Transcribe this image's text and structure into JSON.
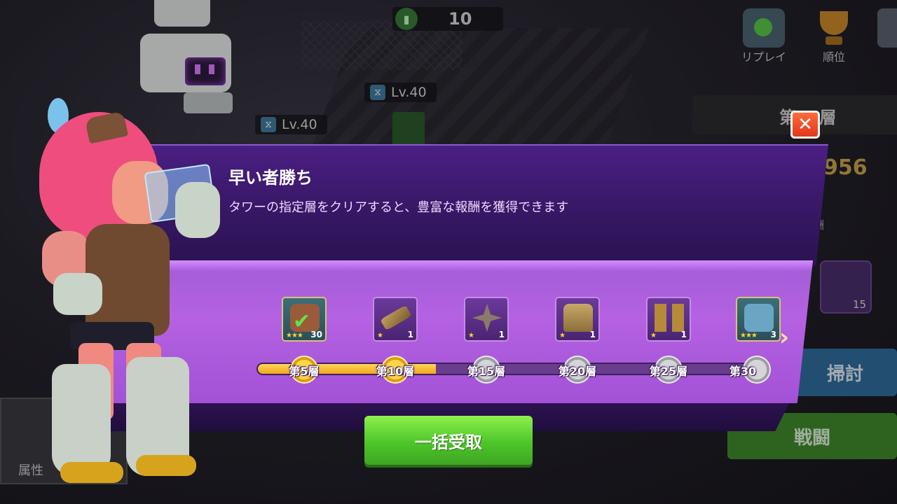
{
  "hud": {
    "energy_count": "10",
    "enemy_levels": [
      "Lv.40",
      "Lv.40"
    ],
    "top_menu": [
      {
        "label": "リプレイ",
        "icon": "replay-icon"
      },
      {
        "label": "順位",
        "icon": "trophy-icon"
      }
    ]
  },
  "background_panel": {
    "floor_title": "第10層",
    "power_value": "956",
    "reward_label": "酬",
    "item_count": "15",
    "sweep_label": "掃討",
    "battle_label": "戦闘",
    "attribute_label": "属性"
  },
  "event": {
    "title": "早い者勝ち",
    "description": "タワーの指定層をクリアすると、豊富な報酬を獲得できます",
    "close_icon": "close-icon",
    "next_icon": "chevron-right-icon",
    "claim_all_label": "一括受取",
    "progress_fraction": 0.35,
    "milestones": [
      {
        "floor_label": "第5層",
        "reward": "hero-shard",
        "count": "30",
        "stars": "★★★",
        "claimed": true,
        "reached": true
      },
      {
        "floor_label": "第10層",
        "reward": "bazooka",
        "count": "1",
        "stars": "★",
        "claimed": false,
        "reached": true
      },
      {
        "floor_label": "第15層",
        "reward": "shuriken",
        "count": "1",
        "stars": "★",
        "claimed": false,
        "reached": false
      },
      {
        "floor_label": "第20層",
        "reward": "armor-vest",
        "count": "1",
        "stars": "★",
        "claimed": false,
        "reached": false
      },
      {
        "floor_label": "第25層",
        "reward": "leg-armor",
        "count": "1",
        "stars": "★",
        "claimed": false,
        "reached": false
      },
      {
        "floor_label": "第30",
        "reward": "hero-shard",
        "count": "3",
        "stars": "★★★",
        "claimed": false,
        "reached": false
      }
    ]
  },
  "colors": {
    "modal_purple": "#a25cd6",
    "claim_green": "#4dc62a",
    "progress_gold": "#f0a820",
    "close_red": "#e0391c"
  }
}
